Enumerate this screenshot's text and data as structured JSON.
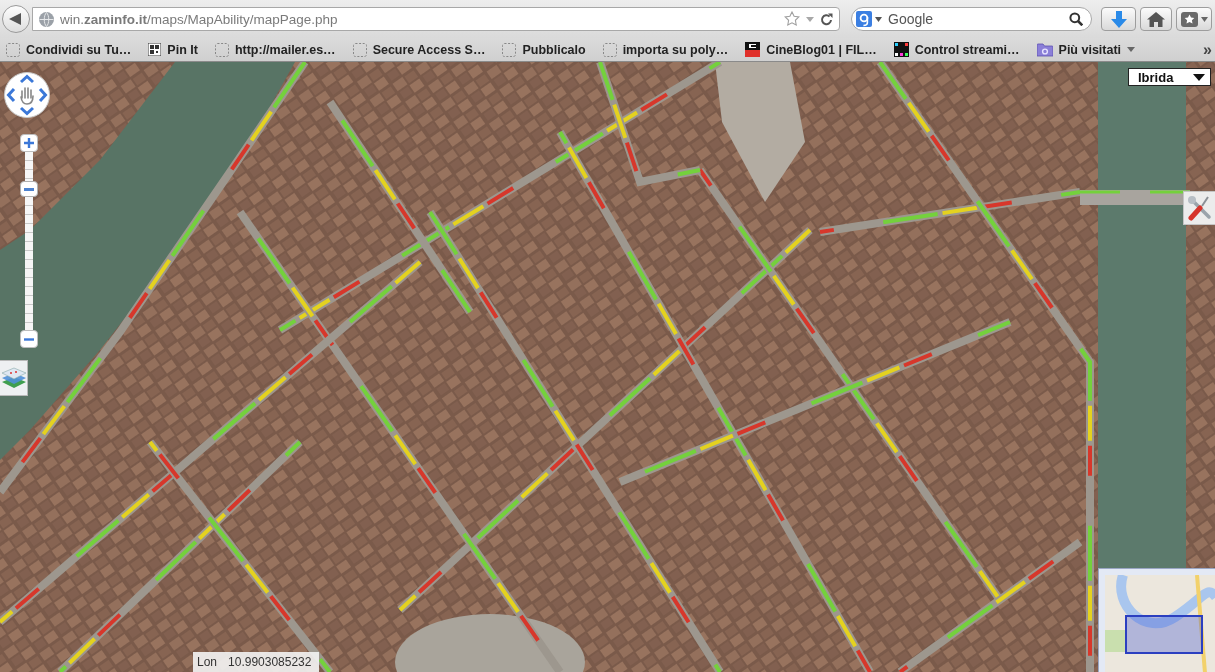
{
  "browser": {
    "address_bar": {
      "url": "win.**zaminfo.it**/maps/MapAbility/mapPage.php"
    },
    "search": {
      "placeholder": "Google"
    },
    "bookmarks": [
      {
        "label": "Condividi su Tu…",
        "kind": "page"
      },
      {
        "label": "Pin It",
        "kind": "qr"
      },
      {
        "label": "http://mailer.es…",
        "kind": "page"
      },
      {
        "label": "Secure Access S…",
        "kind": "page"
      },
      {
        "label": "Pubblicalo",
        "kind": "page"
      },
      {
        "label": "importa su poly…",
        "kind": "page"
      },
      {
        "label": "CineBlog01 | FIL…",
        "kind": "logo"
      },
      {
        "label": "Control streami…",
        "kind": "dots"
      },
      {
        "label": "Più visitati",
        "kind": "folder"
      }
    ],
    "bookmarks_overflow": "»"
  },
  "map": {
    "map_type": "Ibrida",
    "zoom": {
      "level": 0.82
    },
    "coordinates": {
      "label": "Lon",
      "value": "10.9903085232"
    }
  }
}
